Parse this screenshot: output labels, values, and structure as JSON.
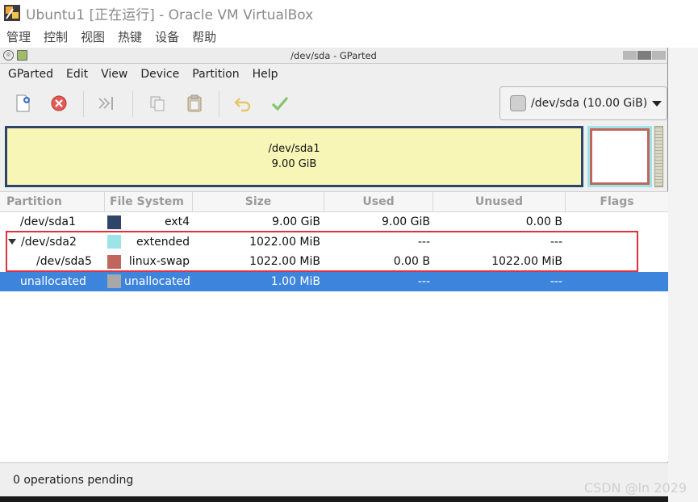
{
  "host_window": {
    "title": "Ubuntu1 [正在运行] - Oracle VM VirtualBox",
    "menu": [
      "管理",
      "控制",
      "视图",
      "热键",
      "设备",
      "帮助"
    ]
  },
  "gparted": {
    "title": "/dev/sda - GParted",
    "menu": [
      "GParted",
      "Edit",
      "View",
      "Device",
      "Partition",
      "Help"
    ],
    "toolbar": [
      "new-partition",
      "delete-partition",
      "resize-move",
      "copy",
      "paste",
      "undo",
      "apply"
    ],
    "device": "/dev/sda (10.00 GiB)",
    "graph": {
      "primary": {
        "name": "/dev/sda1",
        "size": "9.00 GiB"
      }
    },
    "columns": [
      "Partition",
      "File System",
      "Size",
      "Used",
      "Unused",
      "Flags"
    ],
    "rows": [
      {
        "partition": "/dev/sda1",
        "filesystem": "ext4",
        "fs_color": "#2e4468",
        "size": "9.00 GiB",
        "used": "9.00 GiB",
        "unused": "0.00 B",
        "flags": "",
        "indent": 0,
        "expander": false
      },
      {
        "partition": "/dev/sda2",
        "filesystem": "extended",
        "fs_color": "#9de4e8",
        "size": "1022.00 MiB",
        "used": "---",
        "unused": "---",
        "flags": "",
        "indent": 0,
        "expander": true
      },
      {
        "partition": "/dev/sda5",
        "filesystem": "linux-swap",
        "fs_color": "#c0665c",
        "size": "1022.00 MiB",
        "used": "0.00 B",
        "unused": "1022.00 MiB",
        "flags": "",
        "indent": 1,
        "expander": false
      },
      {
        "partition": "unallocated",
        "filesystem": "unallocated",
        "fs_color": "#a8a8a8",
        "size": "1.00 MiB",
        "used": "---",
        "unused": "---",
        "flags": "",
        "indent": 0,
        "expander": false,
        "selected": true
      }
    ],
    "status": "0 operations pending"
  },
  "watermark": "CSDN @ln 2029",
  "colors": {
    "selection": "#3d85dc",
    "highlight_box": "#e0313c"
  }
}
